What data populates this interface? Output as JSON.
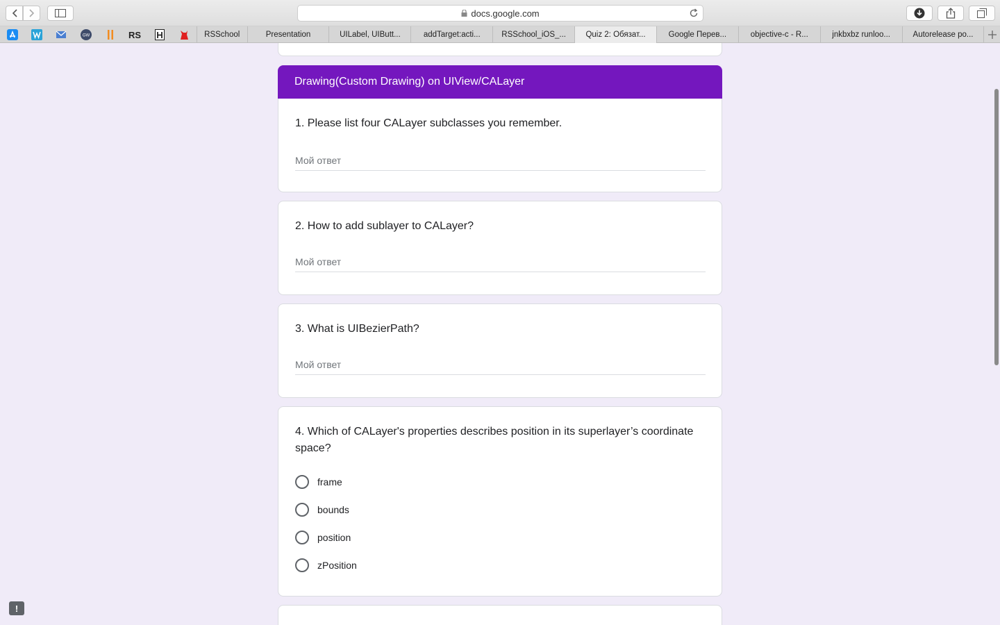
{
  "browser": {
    "url": "docs.google.com",
    "tabs": [
      {
        "label": "RSSchool"
      },
      {
        "label": "Presentation"
      },
      {
        "label": "UILabel, UIButt..."
      },
      {
        "label": "addTarget:acti..."
      },
      {
        "label": "RSSchool_iOS_..."
      },
      {
        "label": "Quiz 2: Обязат...",
        "active": true
      },
      {
        "label": "Google Перев..."
      },
      {
        "label": "objective-c - R..."
      },
      {
        "label": "jnkbxbz runloo..."
      },
      {
        "label": "Autorelease po..."
      }
    ]
  },
  "form": {
    "section_title": "Drawing(Custom Drawing) on UIView/CALayer",
    "answer_placeholder": "Мой ответ",
    "questions": [
      {
        "title": "1. Please list four CALayer subclasses you remember."
      },
      {
        "title": "2. How to add sublayer to CALayer?"
      },
      {
        "title": "3. What is UIBezierPath?"
      },
      {
        "title": "4. Which of CALayer's properties describes position in its superlayer’s coordinate space?",
        "options": [
          "frame",
          "bounds",
          "position",
          "zPosition"
        ]
      }
    ]
  },
  "feedback_icon": "!"
}
